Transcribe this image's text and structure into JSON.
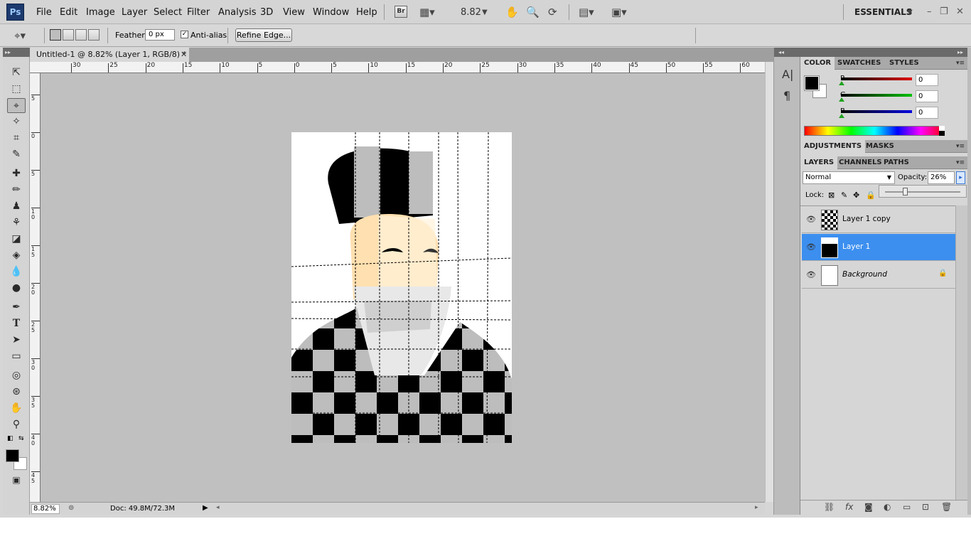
{
  "app": {
    "logo": "Ps",
    "menus": [
      "File",
      "Edit",
      "Image",
      "Layer",
      "Select",
      "Filter",
      "Analysis",
      "3D",
      "View",
      "Window",
      "Help"
    ],
    "bridge_button": "Br",
    "zoom_display": "8.82",
    "workspace": "ESSENTIALS",
    "window_controls": [
      "–",
      "❐",
      "✕"
    ]
  },
  "options_bar": {
    "feather_label": "Feather:",
    "feather_value": "0 px",
    "anti_alias_label": "Anti-alias",
    "anti_alias_checked": true,
    "refine_edge_label": "Refine Edge..."
  },
  "document": {
    "tab_title": "Untitled-1 @ 8.82% (Layer 1, RGB/8) *",
    "tab_close": "✕",
    "ruler_h_labels": [
      "30",
      "25",
      "20",
      "15",
      "10",
      "5",
      "0",
      "5",
      "10",
      "15",
      "20",
      "25",
      "30",
      "35",
      "40",
      "45",
      "50",
      "55",
      "60"
    ],
    "ruler_v_labels": [
      "5",
      "0",
      "5",
      "1 0",
      "1 5",
      "2 0",
      "2 5",
      "3 0",
      "3 5",
      "4 0",
      "4 5"
    ],
    "status_zoom": "8.82%",
    "doc_size": "Doc: 49.8M/72.3M"
  },
  "panels": {
    "color_tabs": [
      "COLOR",
      "SWATCHES",
      "STYLES"
    ],
    "color_sliders": [
      {
        "label": "R",
        "value": "0",
        "color": "#e00000"
      },
      {
        "label": "G",
        "value": "0",
        "color": "#00c000"
      },
      {
        "label": "B",
        "value": "0",
        "color": "#0000e0"
      }
    ],
    "adjust_tabs": [
      "ADJUSTMENTS",
      "MASKS"
    ],
    "layer_tabs": [
      "LAYERS",
      "CHANNELS",
      "PATHS"
    ],
    "blend_mode": "Normal",
    "opacity_label": "Opacity:",
    "opacity_value": "26%",
    "lock_label": "Lock:",
    "layers": [
      {
        "name": "Layer 1 copy",
        "selected": false,
        "locked": false
      },
      {
        "name": "Layer 1",
        "selected": true,
        "locked": false
      },
      {
        "name": "Background",
        "selected": false,
        "locked": true
      }
    ]
  },
  "colors": {
    "accent": "#3c8fef",
    "chrome": "#d6d6d6",
    "canvas_bg": "#c0c0c0"
  }
}
